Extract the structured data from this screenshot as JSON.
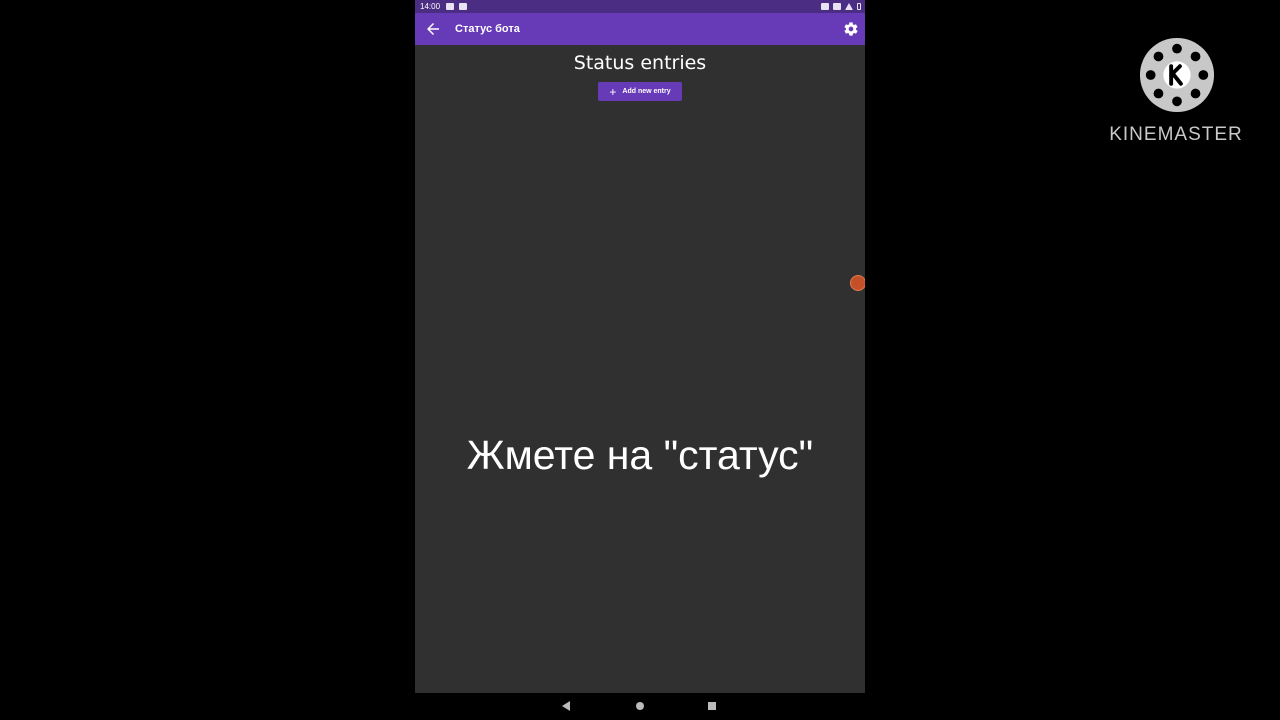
{
  "status_bar": {
    "time": "14:00"
  },
  "app_bar": {
    "title": "Статус бота"
  },
  "main": {
    "heading": "Status entries",
    "add_button": {
      "icon": "+",
      "label": "Add new entry"
    }
  },
  "overlay": {
    "subtitle": "Жмете на \"статус\""
  },
  "watermark": {
    "text": "KINEMASTER"
  },
  "colors": {
    "primary": "#673ab7",
    "status_bar": "#4b2d83",
    "background": "#303030"
  }
}
